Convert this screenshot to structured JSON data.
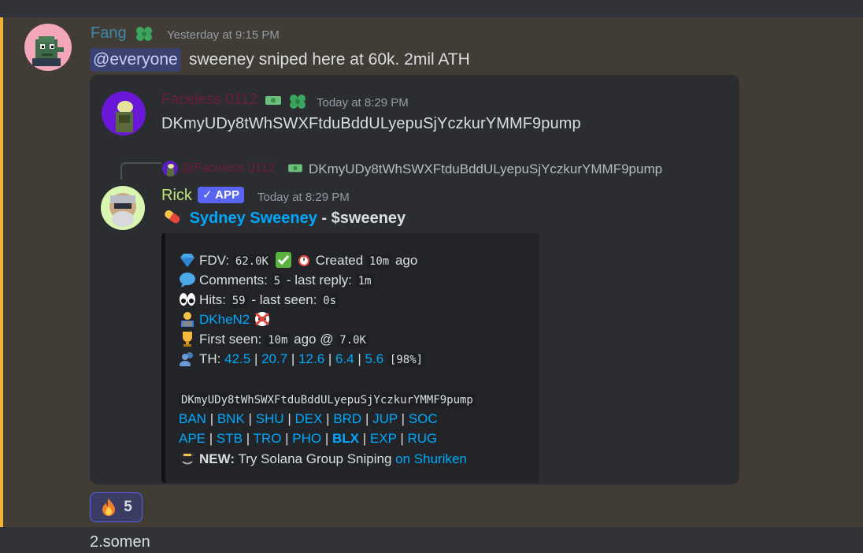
{
  "message": {
    "author": "Fang",
    "timestamp": "Yesterday at 9:15 PM",
    "mention": "@everyone",
    "text": "sweeney sniped here at 60k. 2mil ATH"
  },
  "forwarded": {
    "author": "Faceless 0112",
    "timestamp": "Today at 8:29 PM",
    "content": "DKmyUDy8tWhSWXFtduBddULyepuSjYczkurYMMF9pump"
  },
  "reply": {
    "author": "@Faceless 0112",
    "text": "DKmyUDy8tWhSWXFtduBddULyepuSjYczkurYMMF9pump"
  },
  "bot": {
    "author": "Rick",
    "app_tag": "✓ APP",
    "timestamp": "Today at 8:29 PM",
    "title_name": "Sydney Sweeney",
    "title_sep": " - ",
    "title_ticker": "$sweeney",
    "fdv_label": "FDV:",
    "fdv_value": "62.0K",
    "created_label": "Created",
    "created_value": "10m",
    "created_suffix": "ago",
    "comments_label": "Comments:",
    "comments_value": "5",
    "last_reply_label": "- last reply:",
    "last_reply_value": "1m",
    "hits_label": "Hits:",
    "hits_value": "59",
    "last_seen_label": "- last seen:",
    "last_seen_value": "0s",
    "dev_link": "DKheN2",
    "first_seen_label": "First seen:",
    "first_seen_value": "10m",
    "first_seen_mid": "ago @",
    "first_seen_price": "7.0K",
    "th_label": "TH:",
    "th_values": [
      "42.5",
      "20.7",
      "12.6",
      "6.4",
      "5.6"
    ],
    "th_total": "[98%]",
    "contract": "DKmyUDy8tWhSWXFtduBddULyepuSjYczkurYMMF9pump",
    "links_row1": [
      "BAN",
      "BNK",
      "SHU",
      "DEX",
      "BRD",
      "JUP",
      "SOC"
    ],
    "links_row2": [
      "APE",
      "STB",
      "TRO",
      "PHO",
      "BLX",
      "EXP",
      "RUG"
    ],
    "promo_bold": "NEW:",
    "promo_text": "Try Solana Group Sniping",
    "promo_link": "on Shuriken"
  },
  "reaction": {
    "emoji": "fire-icon",
    "count": "5"
  },
  "next_message": "2.somen",
  "colors": {
    "background": "#313338",
    "highlight": "#413d36",
    "highlight_border": "#f0b232",
    "embed": "#2b2d31",
    "link": "#00a8fc",
    "app_tag": "#5865f2",
    "fang": "#3e88a8",
    "rick": "#bfe678"
  }
}
